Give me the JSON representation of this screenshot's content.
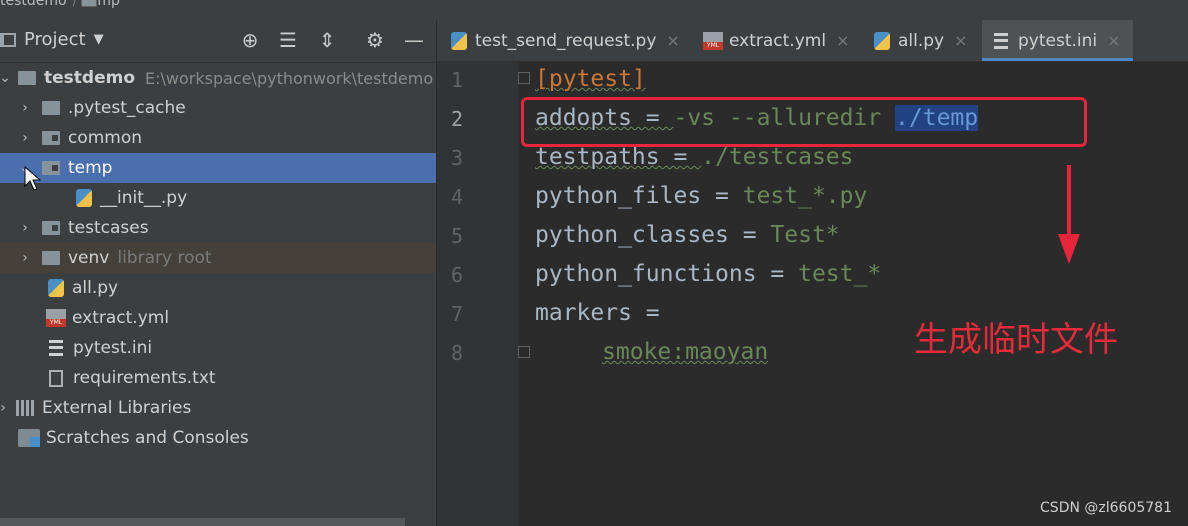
{
  "breadcrumb": {
    "root": "testdemo",
    "sep": "/",
    "current": "temp"
  },
  "project_panel": {
    "title": "Project"
  },
  "tree": [
    {
      "label": "testdemo",
      "path": "E:\\workspace\\pythonwork\\testdemo",
      "type": "root"
    },
    {
      "label": ".pytest_cache",
      "type": "folder"
    },
    {
      "label": "common",
      "type": "folder"
    },
    {
      "label": "temp",
      "type": "folder",
      "selected": true
    },
    {
      "label": "__init__.py",
      "type": "py"
    },
    {
      "label": "testcases",
      "type": "folder"
    },
    {
      "label": "venv",
      "hint": "library root",
      "type": "folder"
    },
    {
      "label": "all.py",
      "type": "py"
    },
    {
      "label": "extract.yml",
      "type": "yml"
    },
    {
      "label": "pytest.ini",
      "type": "ini"
    },
    {
      "label": "requirements.txt",
      "type": "txt"
    },
    {
      "label": "External Libraries",
      "type": "lib"
    },
    {
      "label": "Scratches and Consoles",
      "type": "scratch"
    }
  ],
  "tabs": [
    {
      "label": "test_send_request.py",
      "icon": "python-file-icon"
    },
    {
      "label": "extract.yml",
      "icon": "yml-file-icon"
    },
    {
      "label": "all.py",
      "icon": "python-file-icon"
    },
    {
      "label": "pytest.ini",
      "icon": "ini-file-icon",
      "active": true
    }
  ],
  "code": {
    "line_numbers": [
      "1",
      "2",
      "3",
      "4",
      "5",
      "6",
      "7",
      "8"
    ],
    "l1": "[pytest]",
    "l2_key": "addopts = ",
    "l2_val": "-vs --alluredir ",
    "l2_sel": "./temp",
    "l3_key": "testpaths = ",
    "l3_val": "./testcases",
    "l4_key": "python_files = ",
    "l4_val": "test_*.py",
    "l5_key": "python_classes = ",
    "l5_val": "Test*",
    "l6_key": "python_functions = ",
    "l6_val": "test_*",
    "l7_key": "markers =",
    "l8_val": "smoke:maoyan"
  },
  "annotation": {
    "text": "生成临时文件",
    "color": "#ea2a3a"
  },
  "watermark": "CSDN @zl6605781",
  "colors": {
    "selection": "#4b6eaf",
    "accent": "#4a88c7",
    "annotation_red": "#e8253a"
  }
}
